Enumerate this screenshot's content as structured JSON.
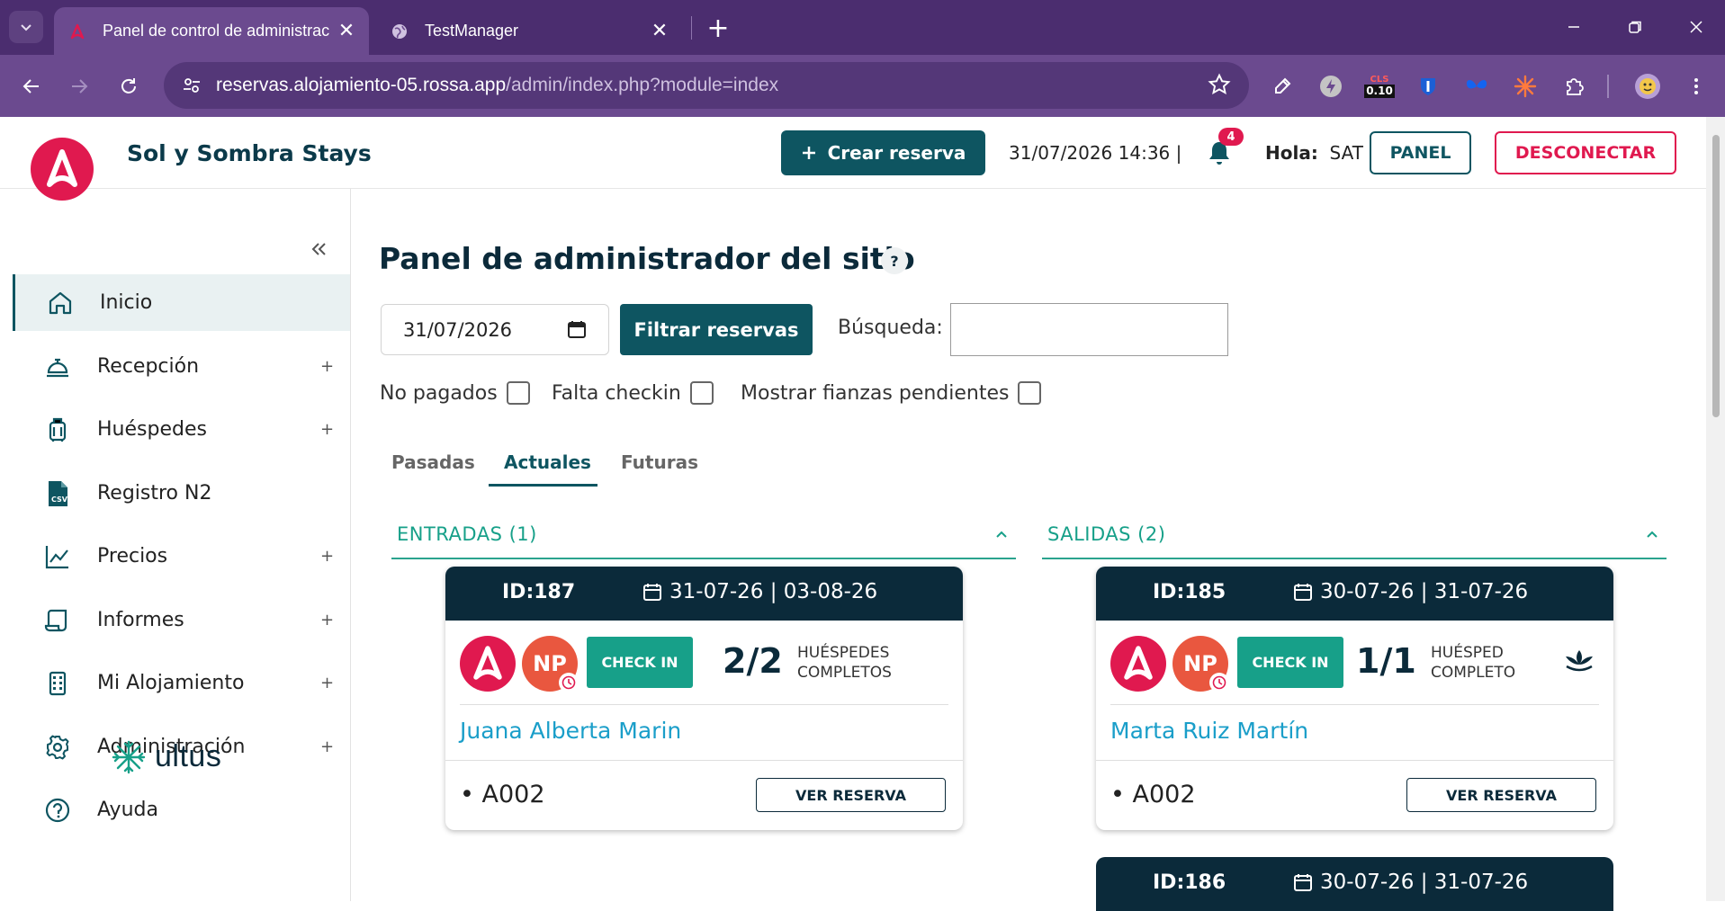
{
  "browser": {
    "tabs": [
      {
        "title": "Panel de control de administrac",
        "active": true
      },
      {
        "title": "TestManager",
        "active": false
      }
    ],
    "url_host": "reservas.alojamiento-05.rossa.app",
    "url_path": "/admin/index.php?module=index",
    "extensions": [
      "eyedropper-icon",
      "lightning-icon",
      "cls-badge-icon",
      "shield-icon",
      "butterfly-icon",
      "burst-icon",
      "puzzle-icon",
      "profile-avatar-icon"
    ],
    "cls_value": "0.10",
    "cls_label": "CLS"
  },
  "header": {
    "brand": "Sol y Sombra Stays",
    "create_label": "Crear reserva",
    "datetime": "31/07/2026 14:36 |",
    "notifications": "4",
    "greeting_label": "Hola:",
    "greeting_user": "SAT",
    "panel_label": "PANEL",
    "logout_label": "DESCONECTAR"
  },
  "sidebar": {
    "items": [
      {
        "label": "Inicio",
        "icon": "home-icon",
        "expandable": false,
        "active": true
      },
      {
        "label": "Recepción",
        "icon": "bell-desk-icon",
        "expandable": true
      },
      {
        "label": "Huéspedes",
        "icon": "luggage-icon",
        "expandable": true
      },
      {
        "label": "Registro N2",
        "icon": "csv-file-icon",
        "expandable": false
      },
      {
        "label": "Precios",
        "icon": "chart-icon",
        "expandable": true
      },
      {
        "label": "Informes",
        "icon": "scroll-icon",
        "expandable": true
      },
      {
        "label": "Mi Alojamiento",
        "icon": "building-icon",
        "expandable": true
      },
      {
        "label": "Administración",
        "icon": "gear-icon",
        "expandable": true
      },
      {
        "label": "Ayuda",
        "icon": "help-circle-icon",
        "expandable": false
      }
    ],
    "plus": "+",
    "footer_logo": "ultus"
  },
  "main": {
    "title": "Panel de administrador del sitio",
    "help": "?",
    "date_value": "31/07/2026",
    "filter_label": "Filtrar reservas",
    "search_label": "Búsqueda:",
    "search_value": "",
    "checks": [
      {
        "label": "No pagados",
        "checked": false
      },
      {
        "label": "Falta checkin",
        "checked": false
      },
      {
        "label": "Mostrar fianzas pendientes",
        "checked": false
      }
    ],
    "tabs": [
      {
        "label": "Pasadas",
        "active": false
      },
      {
        "label": "Actuales",
        "active": true
      },
      {
        "label": "Futuras",
        "active": false
      }
    ],
    "entradas": {
      "title": "ENTRADAS (1)",
      "cards": [
        {
          "id": "ID:187",
          "dates": "31-07-26 | 03-08-26",
          "np": "NP",
          "checkin": "CHECK IN",
          "count": "2/2",
          "count_label_1": "HUÉSPEDES",
          "count_label_2": "COMPLETOS",
          "guest": "Juana Alberta Marin",
          "room": "• A002",
          "button": "VER RESERVA"
        }
      ]
    },
    "salidas": {
      "title": "SALIDAS (2)",
      "cards": [
        {
          "id": "ID:185",
          "dates": "30-07-26 | 31-07-26",
          "np": "NP",
          "checkin": "CHECK IN",
          "count": "1/1",
          "count_label_1": "HUÉSPED",
          "count_label_2": "COMPLETO",
          "guest": "Marta Ruiz Martín",
          "room": "• A002",
          "button": "VER RESERVA"
        },
        {
          "id": "ID:186",
          "dates": "30-07-26 | 31-07-26"
        }
      ]
    }
  },
  "colors": {
    "brand_primary": "#0e5561",
    "brand_dark": "#0b2a3a",
    "accent_red": "#e0194f",
    "accent_green": "#17a089",
    "np_orange": "#e9573f",
    "link_blue": "#1a9ec9"
  }
}
